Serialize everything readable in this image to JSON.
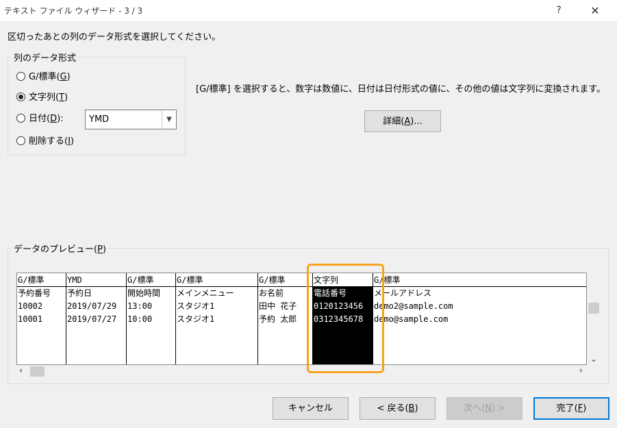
{
  "window": {
    "title": "テキスト ファイル ウィザード - 3 / 3",
    "help_label": "?",
    "close_label": "✕"
  },
  "instruction": "区切ったあとの列のデータ形式を選択してください。",
  "column_format": {
    "legend": "列のデータ形式",
    "options": [
      {
        "label_before": "G/標準(",
        "key": "G",
        "label_after": ")",
        "checked": false
      },
      {
        "label_before": "文字列(",
        "key": "T",
        "label_after": ")",
        "checked": true
      },
      {
        "label_before": "日付(",
        "key": "D",
        "label_after": "):",
        "checked": false
      },
      {
        "label_before": "削除する(",
        "key": "I",
        "label_after": ")",
        "checked": false
      }
    ],
    "date_format_value": "YMD"
  },
  "description": "[G/標準] を選択すると、数字は数値に、日付は日付形式の値に、その他の値は文字列に変換されます。",
  "detail_button": {
    "before": "詳細(",
    "key": "A",
    "after": ")..."
  },
  "preview": {
    "legend_before": "データのプレビュー(",
    "legend_key": "P",
    "legend_after": ")",
    "columns": [
      {
        "header": "G/標準",
        "cells": [
          "予約番号",
          "10002",
          "10001"
        ]
      },
      {
        "header": "YMD",
        "cells": [
          "予約日",
          "2019/07/29",
          "2019/07/27"
        ]
      },
      {
        "header": "G/標準",
        "cells": [
          "開始時間",
          "13:00",
          "10:00"
        ]
      },
      {
        "header": "G/標準",
        "cells": [
          "メインメニュー",
          "スタジオ1",
          "スタジオ1"
        ]
      },
      {
        "header": "G/標準",
        "cells": [
          "お名前",
          "田中 花子",
          "予約 太郎"
        ]
      },
      {
        "header": "文字列",
        "cells": [
          "電話番号",
          "0120123456",
          "0312345678"
        ]
      },
      {
        "header": "G/標準",
        "cells": [
          "メールアドレス",
          "demo2@sample.com",
          "demo@sample.com"
        ]
      }
    ]
  },
  "buttons": {
    "cancel": "キャンセル",
    "back": {
      "before": "< 戻る(",
      "key": "B",
      "after": ")"
    },
    "next": {
      "before": "次へ(",
      "key": "N",
      "after": ") >"
    },
    "finish": {
      "before": "完了(",
      "key": "F",
      "after": ")"
    }
  },
  "colors": {
    "highlight": "#f7a21c",
    "focus": "#0078d7"
  }
}
